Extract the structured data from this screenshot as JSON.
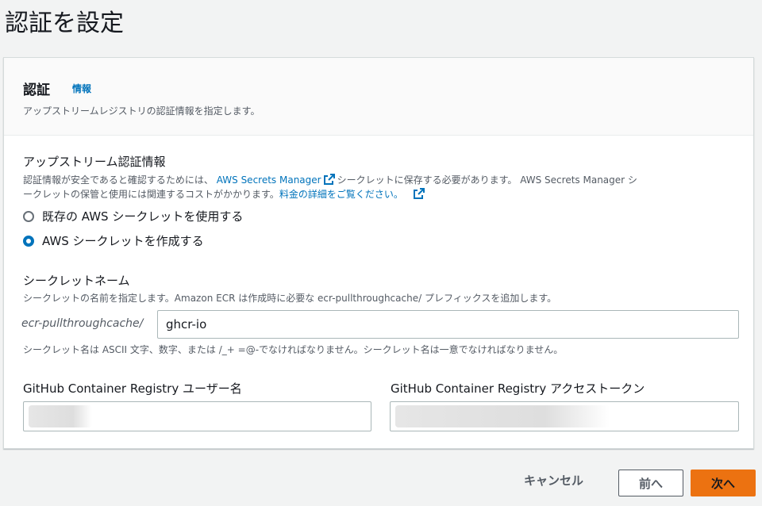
{
  "page": {
    "title": "認証を設定"
  },
  "panel": {
    "title": "認証",
    "info_link": "情報",
    "description": "アップストリームレジストリの認証情報を指定します。"
  },
  "credentials": {
    "label": "アップストリーム認証情報",
    "help_part1": "認証情報が安全であると確認するためには、",
    "link_secrets_manager": "AWS Secrets Manager",
    "help_part2": "シークレットに保存する必要があります。 AWS Secrets Manager シ",
    "help_line2": "ークレットの保管と使用には関連するコストがかかります。",
    "link_pricing": "料金の詳細をご覧ください。",
    "options": [
      {
        "label": "既存の AWS シークレットを使用する",
        "checked": false
      },
      {
        "label": "AWS シークレットを作成する",
        "checked": true
      }
    ]
  },
  "secret_name": {
    "label": "シークレットネーム",
    "help": "シークレットの名前を指定します。Amazon ECR は作成時に必要な ecr-pullthroughcache/ プレフィックスを追加します。",
    "prefix": "ecr-pullthroughcache/",
    "value": "ghcr-io",
    "constraint": "シークレット名は ASCII 文字、数字、または /_+ =@-でなければなりません。シークレット名は一意でなければなりません。"
  },
  "username": {
    "label": "GitHub Container Registry ユーザー名"
  },
  "token": {
    "label": "GitHub Container Registry アクセストークン"
  },
  "footer": {
    "cancel_label": "キャンセル",
    "prev_label": "前へ",
    "next_label": "次へ"
  },
  "colors": {
    "link": "#0073bb",
    "primary": "#ec7211",
    "background": "#f2f3f3"
  },
  "icons": {
    "external_link": "external-link-icon"
  }
}
